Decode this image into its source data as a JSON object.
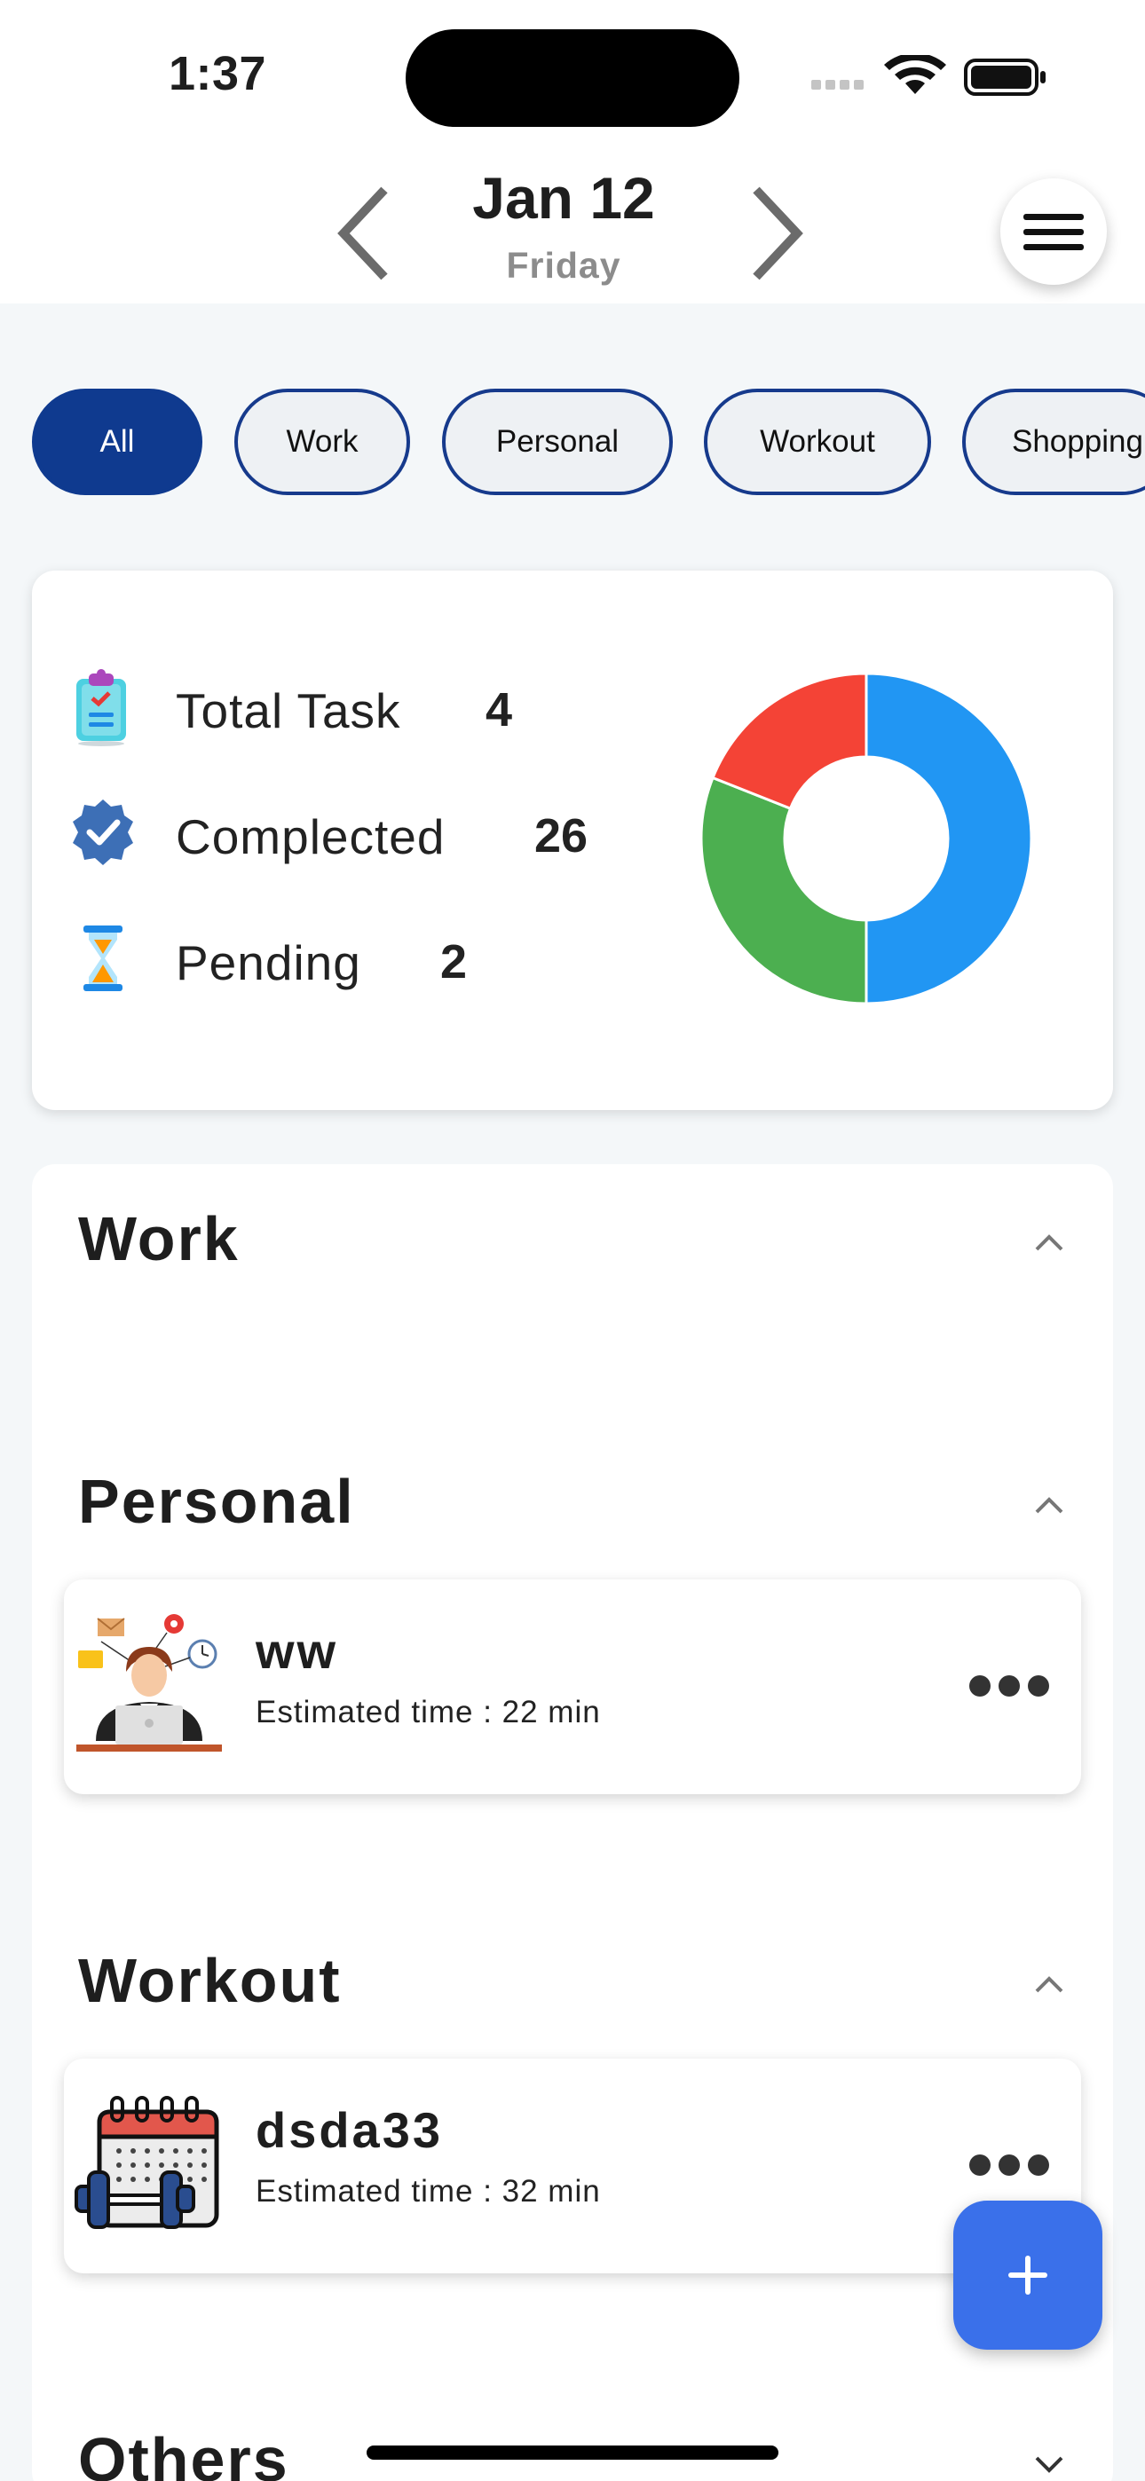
{
  "status_bar": {
    "time": "1:37"
  },
  "header": {
    "date": "Jan 12",
    "weekday": "Friday"
  },
  "filters": [
    "All",
    "Work",
    "Personal",
    "Workout",
    "Shopping"
  ],
  "summary": {
    "total_label": "Total Task",
    "total_value": "4",
    "completed_label": "Complected",
    "completed_value": "26",
    "pending_label": "Pending",
    "pending_value": "2",
    "chart_data": {
      "type": "pie",
      "categories": [
        "blue",
        "green",
        "red"
      ],
      "values": [
        50,
        31,
        19
      ],
      "colors": [
        "#2196f3",
        "#4caf50",
        "#f44336"
      ]
    }
  },
  "sections": {
    "work": {
      "title": "Work"
    },
    "personal": {
      "title": "Personal",
      "task": {
        "name": "ww",
        "time": "Estimated time : 22 min"
      }
    },
    "workout": {
      "title": "Workout",
      "task": {
        "name": "dsda33",
        "time": "Estimated time : 32 min"
      }
    },
    "others": {
      "title": "Others"
    }
  }
}
